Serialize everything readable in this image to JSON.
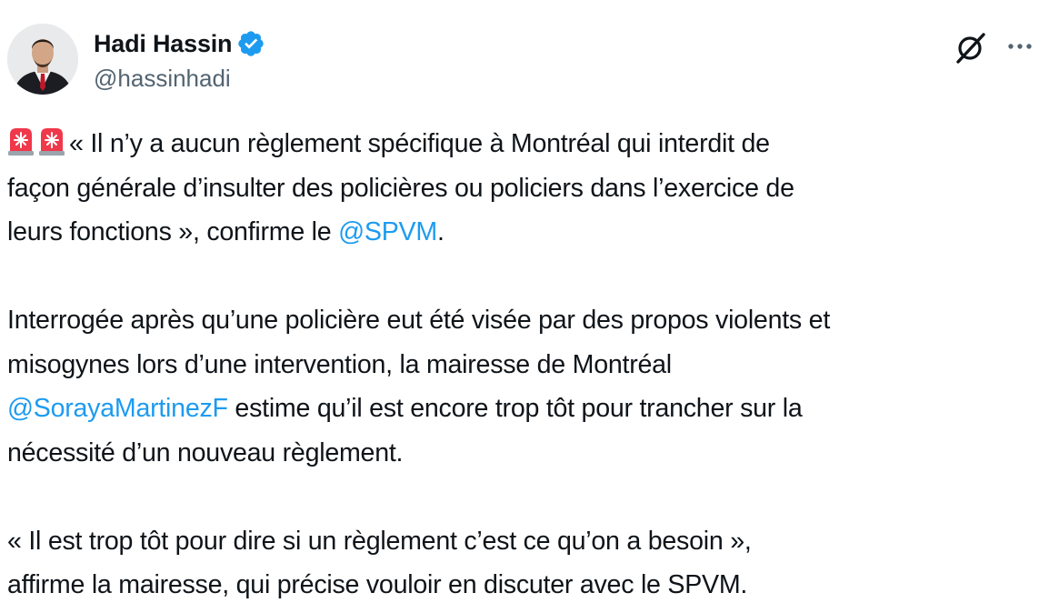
{
  "author": {
    "name": "Hadi Hassin",
    "handle": "@hassinhadi",
    "verified": true,
    "verified_color": "#1d9bf0"
  },
  "icons": {
    "avatar": "profile-photo",
    "verified": "verified-badge-icon",
    "grok": "grok-icon",
    "more": "more-icon",
    "emoji": "police-car-light-icon"
  },
  "colors": {
    "text": "#0f1419",
    "secondary": "#536471",
    "link": "#1d9bf0",
    "siren": "#f0384b"
  },
  "tweet": {
    "p1": {
      "l1": "« Il n’y a aucun règlement spécifique à Montréal qui interdit de",
      "l2": "façon générale d’insulter des policières ou policiers dans l’exercice de",
      "l3_pre": "leurs fonctions », confirme le ",
      "l3_mention": "@SPVM",
      "l3_post": "."
    },
    "p2": {
      "l1": "Interrogée après qu’une policière eut été visée par des propos violents et",
      "l2": "misogynes lors d’une intervention, la mairesse de Montréal",
      "l3_mention": "@SorayaMartinezF",
      "l3_post": " estime qu’il est encore trop tôt pour trancher sur la",
      "l4": "nécessité d’un nouveau règlement."
    },
    "p3": {
      "l1": "« Il est trop tôt pour dire si un règlement c’est ce qu’on a besoin »,",
      "l2": "affirme la mairesse, qui précise vouloir en discuter avec le SPVM."
    }
  }
}
